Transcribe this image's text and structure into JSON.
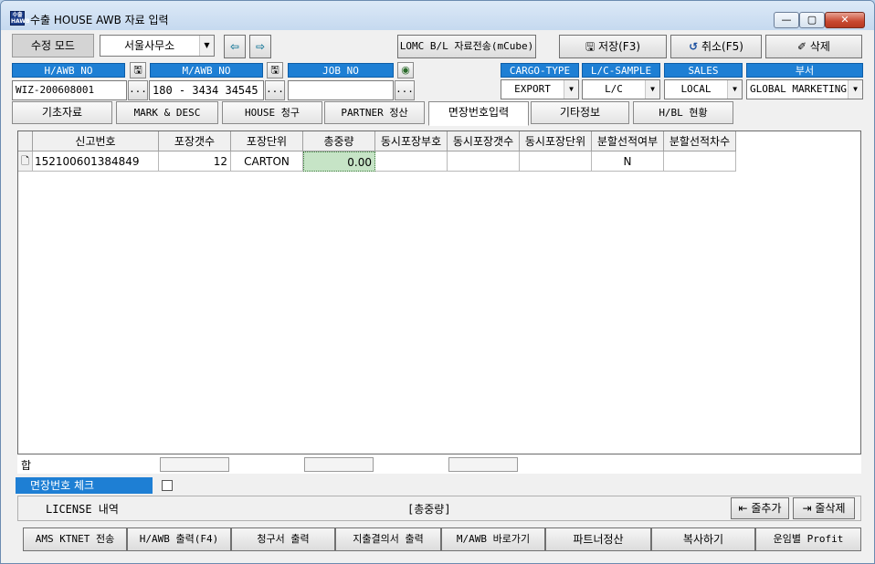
{
  "window": {
    "icon_text": "수출 HAWB",
    "title": "수출 HOUSE AWB 자료 입력",
    "min_glyph": "—",
    "max_glyph": "▢",
    "close_glyph": "✕"
  },
  "toolbar": {
    "mode_label": "수정 모드",
    "office_value": "서울사무소",
    "prev_arrow": "⇦",
    "next_arrow": "⇨",
    "lomc_label": "LOMC B/L 자료전송(mCube)",
    "save_label": "저장(F3)",
    "cancel_label": "취소(F5)",
    "delete_label": "삭제",
    "save_icon": "🖫",
    "cancel_icon": "↺",
    "delete_icon": "✐"
  },
  "fields": {
    "hawb_label": "H/AWB NO",
    "hawb_value": "WIZ-200608001",
    "mawb_label": "M/AWB NO",
    "mawb_value": "180 - 3434 34545",
    "job_label": "JOB NO",
    "job_value": "",
    "cargo_type_label": "CARGO-TYPE",
    "cargo_type_value": "EXPORT",
    "lc_sample_label": "L/C-SAMPLE",
    "lc_sample_value": "L/C",
    "sales_label": "SALES",
    "sales_value": "LOCAL",
    "dept_label": "부서",
    "dept_value": "GLOBAL MARKETING",
    "ellipsis": "...",
    "save_icon": "🖫",
    "globe_icon": "◉",
    "dropdown_arrow": "▼"
  },
  "tabs": [
    {
      "label": "기초자료"
    },
    {
      "label": "MARK & DESC"
    },
    {
      "label": "HOUSE 청구"
    },
    {
      "label": "PARTNER 정산"
    },
    {
      "label": "면장번호입력"
    },
    {
      "label": "기타정보"
    },
    {
      "label": "H/BL 현황"
    }
  ],
  "grid": {
    "columns": [
      "신고번호",
      "포장갯수",
      "포장단위",
      "총중량",
      "동시포장부호",
      "동시포장갯수",
      "동시포장단위",
      "분할선적여부",
      "분할선적차수"
    ],
    "rows": [
      {
        "icon": "🗋",
        "cells": [
          "152100601384849",
          "12",
          "CARTON",
          "0.00",
          "",
          "",
          "",
          "N",
          ""
        ]
      }
    ],
    "sum_label": "합"
  },
  "check": {
    "label": "면장번호 체크"
  },
  "license": {
    "label": "LICENSE 내역",
    "total_label": "[총중량]",
    "add_row_label": "줄추가",
    "delete_row_label": "줄삭제",
    "add_row_icon": "⇤",
    "delete_row_icon": "⇥"
  },
  "bottom_buttons": [
    {
      "label": "AMS KTNET 전송"
    },
    {
      "label": "H/AWB 출력(F4)"
    },
    {
      "label": "청구서 출력"
    },
    {
      "label": "지출결의서 출력"
    },
    {
      "label": "M/AWB 바로가기"
    },
    {
      "label": "파트너정산"
    },
    {
      "label": "복사하기"
    },
    {
      "label": "운임별 Profit"
    }
  ]
}
